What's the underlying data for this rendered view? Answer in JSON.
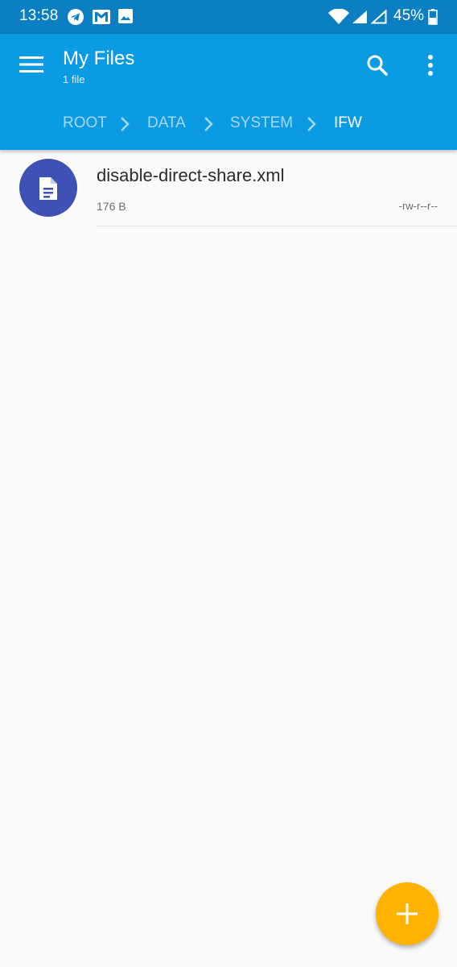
{
  "status_bar": {
    "time": "13:58",
    "battery": "45%",
    "left_icons": [
      "telegram-icon",
      "gmail-icon",
      "gallery-icon"
    ],
    "right_icons": [
      "wifi-icon",
      "signal-icon",
      "signal-empty-icon",
      "battery-icon"
    ]
  },
  "app_bar": {
    "title": "My Files",
    "subtitle": "1 file",
    "icons": [
      "menu-icon",
      "search-icon",
      "more-vert-icon"
    ],
    "color": "#0b9be3"
  },
  "breadcrumb": {
    "items": [
      {
        "label": "ROOT",
        "active": false
      },
      {
        "label": "DATA",
        "active": false
      },
      {
        "label": "SYSTEM",
        "active": false
      },
      {
        "label": "IFW",
        "active": true
      }
    ],
    "separator_icon": "chevron-right-icon"
  },
  "files": [
    {
      "name": "disable-direct-share.xml",
      "size": "176 B",
      "permissions": "-rw-r--r--",
      "icon": "document-icon",
      "icon_color": "#3f51b5"
    }
  ],
  "fab": {
    "icon": "plus-icon",
    "color": "#ffb300"
  }
}
